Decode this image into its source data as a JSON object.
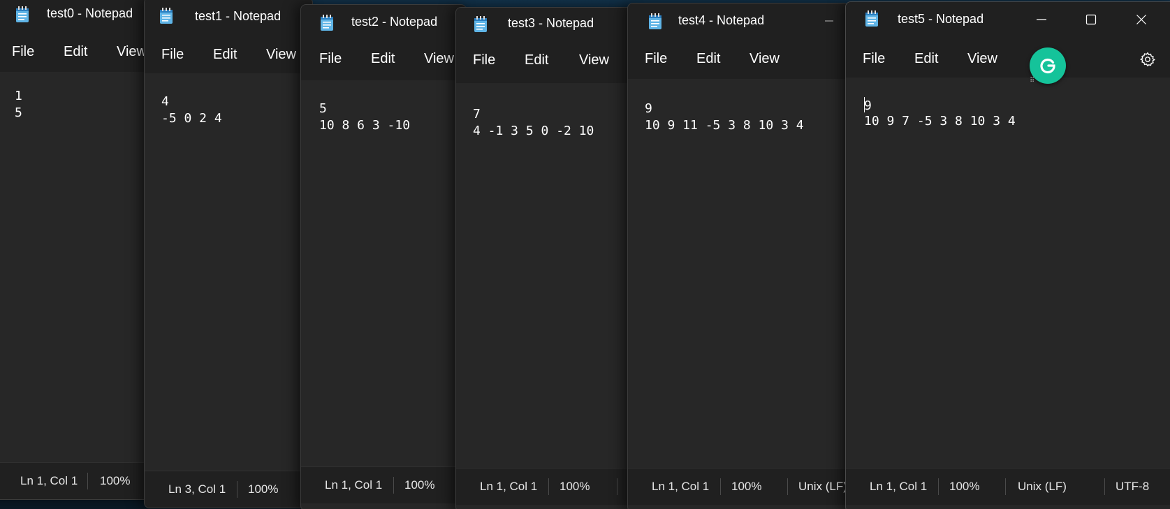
{
  "menu": {
    "file": "File",
    "edit": "Edit",
    "view": "View"
  },
  "windows": [
    {
      "title": "test0 - Notepad",
      "lines": [
        "1",
        "5"
      ],
      "status": {
        "position": "Ln 1, Col 1",
        "zoom": "100%"
      }
    },
    {
      "title": "test1 - Notepad",
      "lines": [
        "4",
        "-5 0 2 4"
      ],
      "status": {
        "position": "Ln 3, Col 1",
        "zoom": "100%"
      }
    },
    {
      "title": "test2 - Notepad",
      "lines": [
        "5",
        "10 8 6 3 -10"
      ],
      "status": {
        "position": "Ln 1, Col 1",
        "zoom": "100%"
      }
    },
    {
      "title": "test3 - Notepad",
      "lines": [
        "7",
        "4 -1 3 5 0 -2 10"
      ],
      "status": {
        "position": "Ln 1, Col 1",
        "zoom": "100%"
      }
    },
    {
      "title": "test4 - Notepad",
      "lines": [
        "9",
        "10 9 11 -5 3 8 10 3 4"
      ],
      "status": {
        "position": "Ln 1, Col 1",
        "zoom": "100%",
        "line_ending": "Unix (LF)"
      }
    },
    {
      "title": "test5 - Notepad",
      "lines": [
        "9",
        "10 9 7 -5 3 8 10 3 4"
      ],
      "status": {
        "position": "Ln 1, Col 1",
        "zoom": "100%",
        "line_ending": "Unix (LF)",
        "encoding": "UTF-8"
      }
    }
  ],
  "icons": {
    "app": "notepad-icon",
    "minimize": "minimize-icon",
    "maximize": "maximize-icon",
    "close": "close-icon",
    "settings": "gear-icon",
    "extension": "grammarly-icon"
  },
  "colors": {
    "window_bg": "#272727",
    "chrome_bg": "#202020",
    "grammarly": "#15c39a"
  }
}
